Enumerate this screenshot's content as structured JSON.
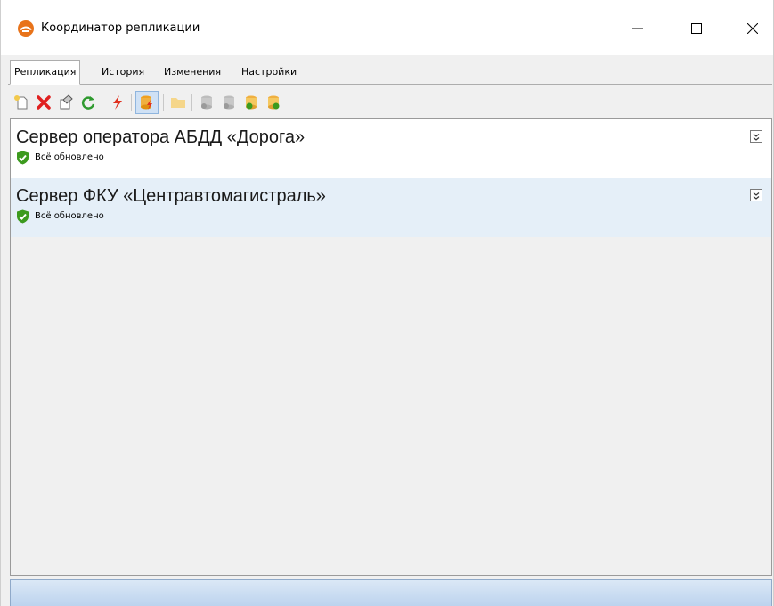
{
  "window": {
    "title": "Координатор репликации",
    "app_icon": "replication-coordinator-icon",
    "controls": [
      "minimize-icon",
      "maximize-icon",
      "close-icon"
    ]
  },
  "tabs": [
    {
      "label": "Репликация",
      "active": true
    },
    {
      "label": "История",
      "active": false
    },
    {
      "label": "Изменения",
      "active": false
    },
    {
      "label": "Настройки",
      "active": false
    }
  ],
  "toolbar": {
    "buttons": [
      {
        "icon": "new-icon",
        "enabled": true
      },
      {
        "icon": "delete-icon",
        "enabled": true
      },
      {
        "icon": "properties-icon",
        "enabled": true
      },
      {
        "icon": "refresh-icon",
        "enabled": true
      },
      {
        "icon": "lightning-icon",
        "enabled": true
      },
      {
        "icon": "database-lightning-icon",
        "enabled": true,
        "pressed": true
      },
      {
        "icon": "folder-icon",
        "enabled": false
      },
      {
        "icon": "database-disabled-icon-1",
        "enabled": false
      },
      {
        "icon": "database-disabled-icon-2",
        "enabled": false
      },
      {
        "icon": "database-sync-icon-1",
        "enabled": true
      },
      {
        "icon": "database-sync-icon-2",
        "enabled": true
      }
    ]
  },
  "servers": [
    {
      "name": "Сервер оператора АБДД «Дорога»",
      "status": "Всё обновлено",
      "status_icon": "shield-check-icon"
    },
    {
      "name": "Сервер ФКУ «Центравтомагистраль»",
      "status": "Всё обновлено",
      "status_icon": "shield-check-icon"
    }
  ],
  "colors": {
    "selected_row": "#e5eff8",
    "status_ok": "#3c9a1e",
    "delete_red": "#e02020",
    "refresh_green": "#2f9a2f"
  }
}
